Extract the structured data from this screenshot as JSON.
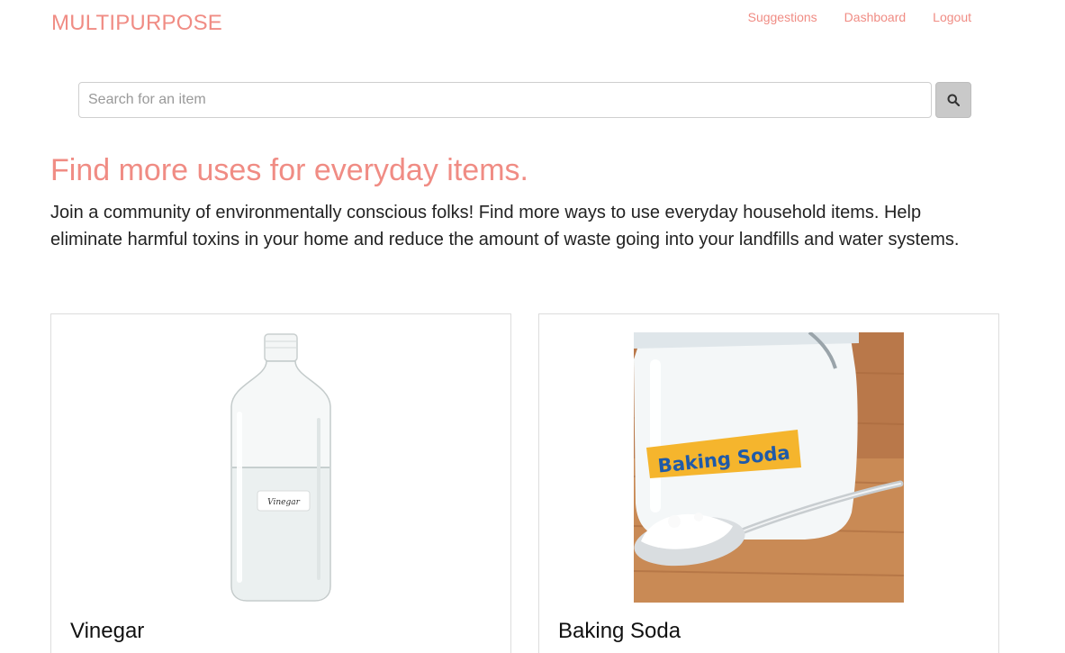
{
  "header": {
    "brand": "MULTIPURPOSE",
    "nav": [
      {
        "label": "Suggestions"
      },
      {
        "label": "Dashboard"
      },
      {
        "label": "Logout"
      }
    ]
  },
  "search": {
    "placeholder": "Search for an item",
    "button_icon": "search-icon"
  },
  "hero": {
    "headline": "Find more uses for everyday items.",
    "intro": "Join a community of environmentally conscious folks! Find more ways to use everyday household items. Help eliminate harmful toxins in your home and reduce the amount of waste going into your landfills and water systems."
  },
  "items": [
    {
      "title": "Vinegar",
      "bottle_label": "Vinegar",
      "image_icon": "vinegar-bottle-image"
    },
    {
      "title": "Baking Soda",
      "jar_label": "Baking Soda",
      "image_icon": "baking-soda-jar-image"
    }
  ],
  "colors": {
    "accent": "#f08c84",
    "text": "#222222",
    "border": "#dddddd",
    "button": "#c9c9c9"
  }
}
